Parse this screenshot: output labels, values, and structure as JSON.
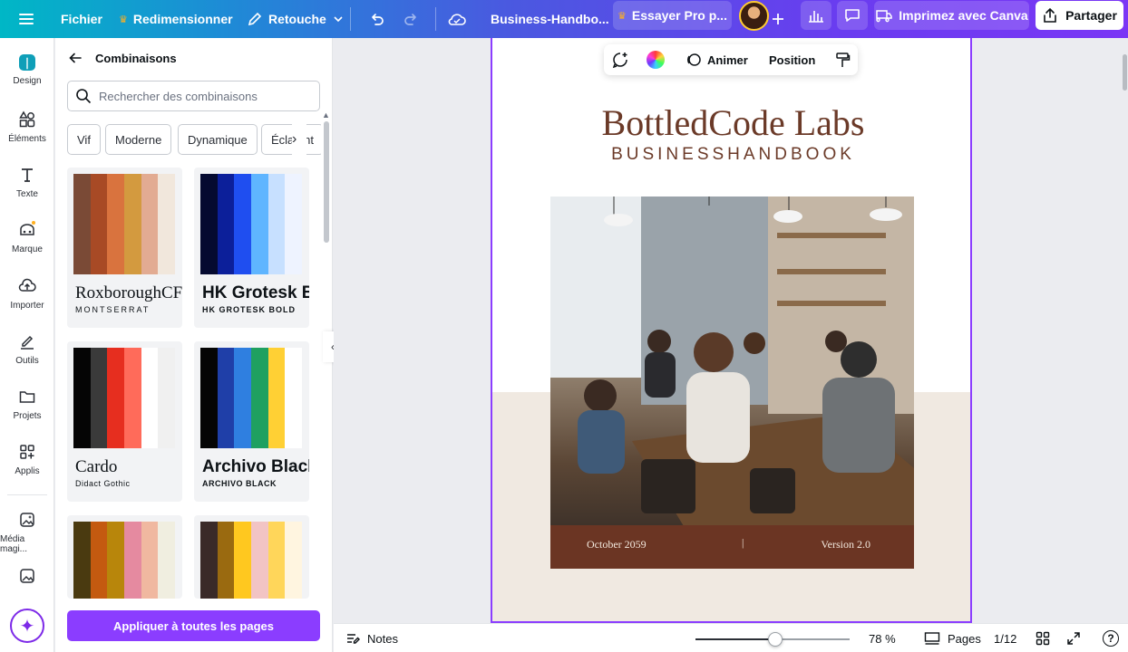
{
  "topbar": {
    "file_label": "Fichier",
    "resize_label": "Redimensionner",
    "retouch_label": "Retouche",
    "doc_title": "Business-Handbo...",
    "try_pro_label": "Essayer Pro p...",
    "print_label": "Imprimez avec Canva",
    "share_label": "Partager"
  },
  "rail": {
    "items": [
      {
        "label": "Design",
        "icon": "design-icon"
      },
      {
        "label": "Éléments",
        "icon": "elements-icon"
      },
      {
        "label": "Texte",
        "icon": "text-icon"
      },
      {
        "label": "Marque",
        "icon": "brand-icon"
      },
      {
        "label": "Importer",
        "icon": "upload-icon"
      },
      {
        "label": "Outils",
        "icon": "draw-icon"
      },
      {
        "label": "Projets",
        "icon": "folder-icon"
      },
      {
        "label": "Applis",
        "icon": "apps-icon"
      },
      {
        "label": "Média magi...",
        "icon": "magic-media-icon"
      }
    ]
  },
  "panel": {
    "title": "Combinaisons",
    "search_placeholder": "Rechercher des combinaisons",
    "chips": [
      "Vif",
      "Moderne",
      "Dynamique",
      "Éclatant"
    ],
    "combos": [
      {
        "colors": [
          "#7a4a36",
          "#a84a25",
          "#d9733e",
          "#d39a3f",
          "#e2ab92",
          "#f1e7dc"
        ],
        "font_main": "RoxboroughCF",
        "font_sub": "MONTSERRAT"
      },
      {
        "colors": [
          "#050a30",
          "#0c1f9a",
          "#1f4ef0",
          "#5fb5ff",
          "#c7e0ff",
          "#eef3ff"
        ],
        "font_main": "HK Grotesk Bold",
        "font_sub": "HK GROTESK BOLD"
      },
      {
        "colors": [
          "#050505",
          "#3a3a3a",
          "#e62e1f",
          "#ff6b5a",
          "#ffffff",
          "#f0f0f0"
        ],
        "font_main": "Cardo",
        "font_sub": "Didact Gothic"
      },
      {
        "colors": [
          "#050505",
          "#1f3fa8",
          "#2f7fe0",
          "#1fa060",
          "#ffd034",
          "#ffffff"
        ],
        "font_main": "Archivo Black",
        "font_sub": "ARCHIVO BLACK"
      },
      {
        "colors": [
          "#4a3a10",
          "#c45a10",
          "#b8860b",
          "#e58aa0",
          "#f0b8a0",
          "#f0eee0"
        ],
        "font_main": "",
        "font_sub": ""
      },
      {
        "colors": [
          "#3a2a28",
          "#9a6a10",
          "#ffc81f",
          "#f2c4c4",
          "#ffd65a",
          "#fff5e0"
        ],
        "font_main": "",
        "font_sub": ""
      }
    ],
    "apply_label": "Appliquer à toutes les pages"
  },
  "float_toolbar": {
    "animate_label": "Animer",
    "position_label": "Position"
  },
  "page": {
    "brand_title": "BottledCode Labs",
    "brand_subtitle": "BUSINESSHANDBOOK",
    "footer_left": "October 2059",
    "footer_mid": "|",
    "footer_right": "Version 2.0"
  },
  "bottombar": {
    "notes_label": "Notes",
    "zoom_value": 78,
    "zoom_label": "78 %",
    "pages_label": "Pages",
    "page_count": "1/12",
    "help_label": "?"
  },
  "colors": {
    "accent": "#8b3dff",
    "brand_brown": "#6b3a28",
    "page_beige": "#f0e9e1"
  }
}
